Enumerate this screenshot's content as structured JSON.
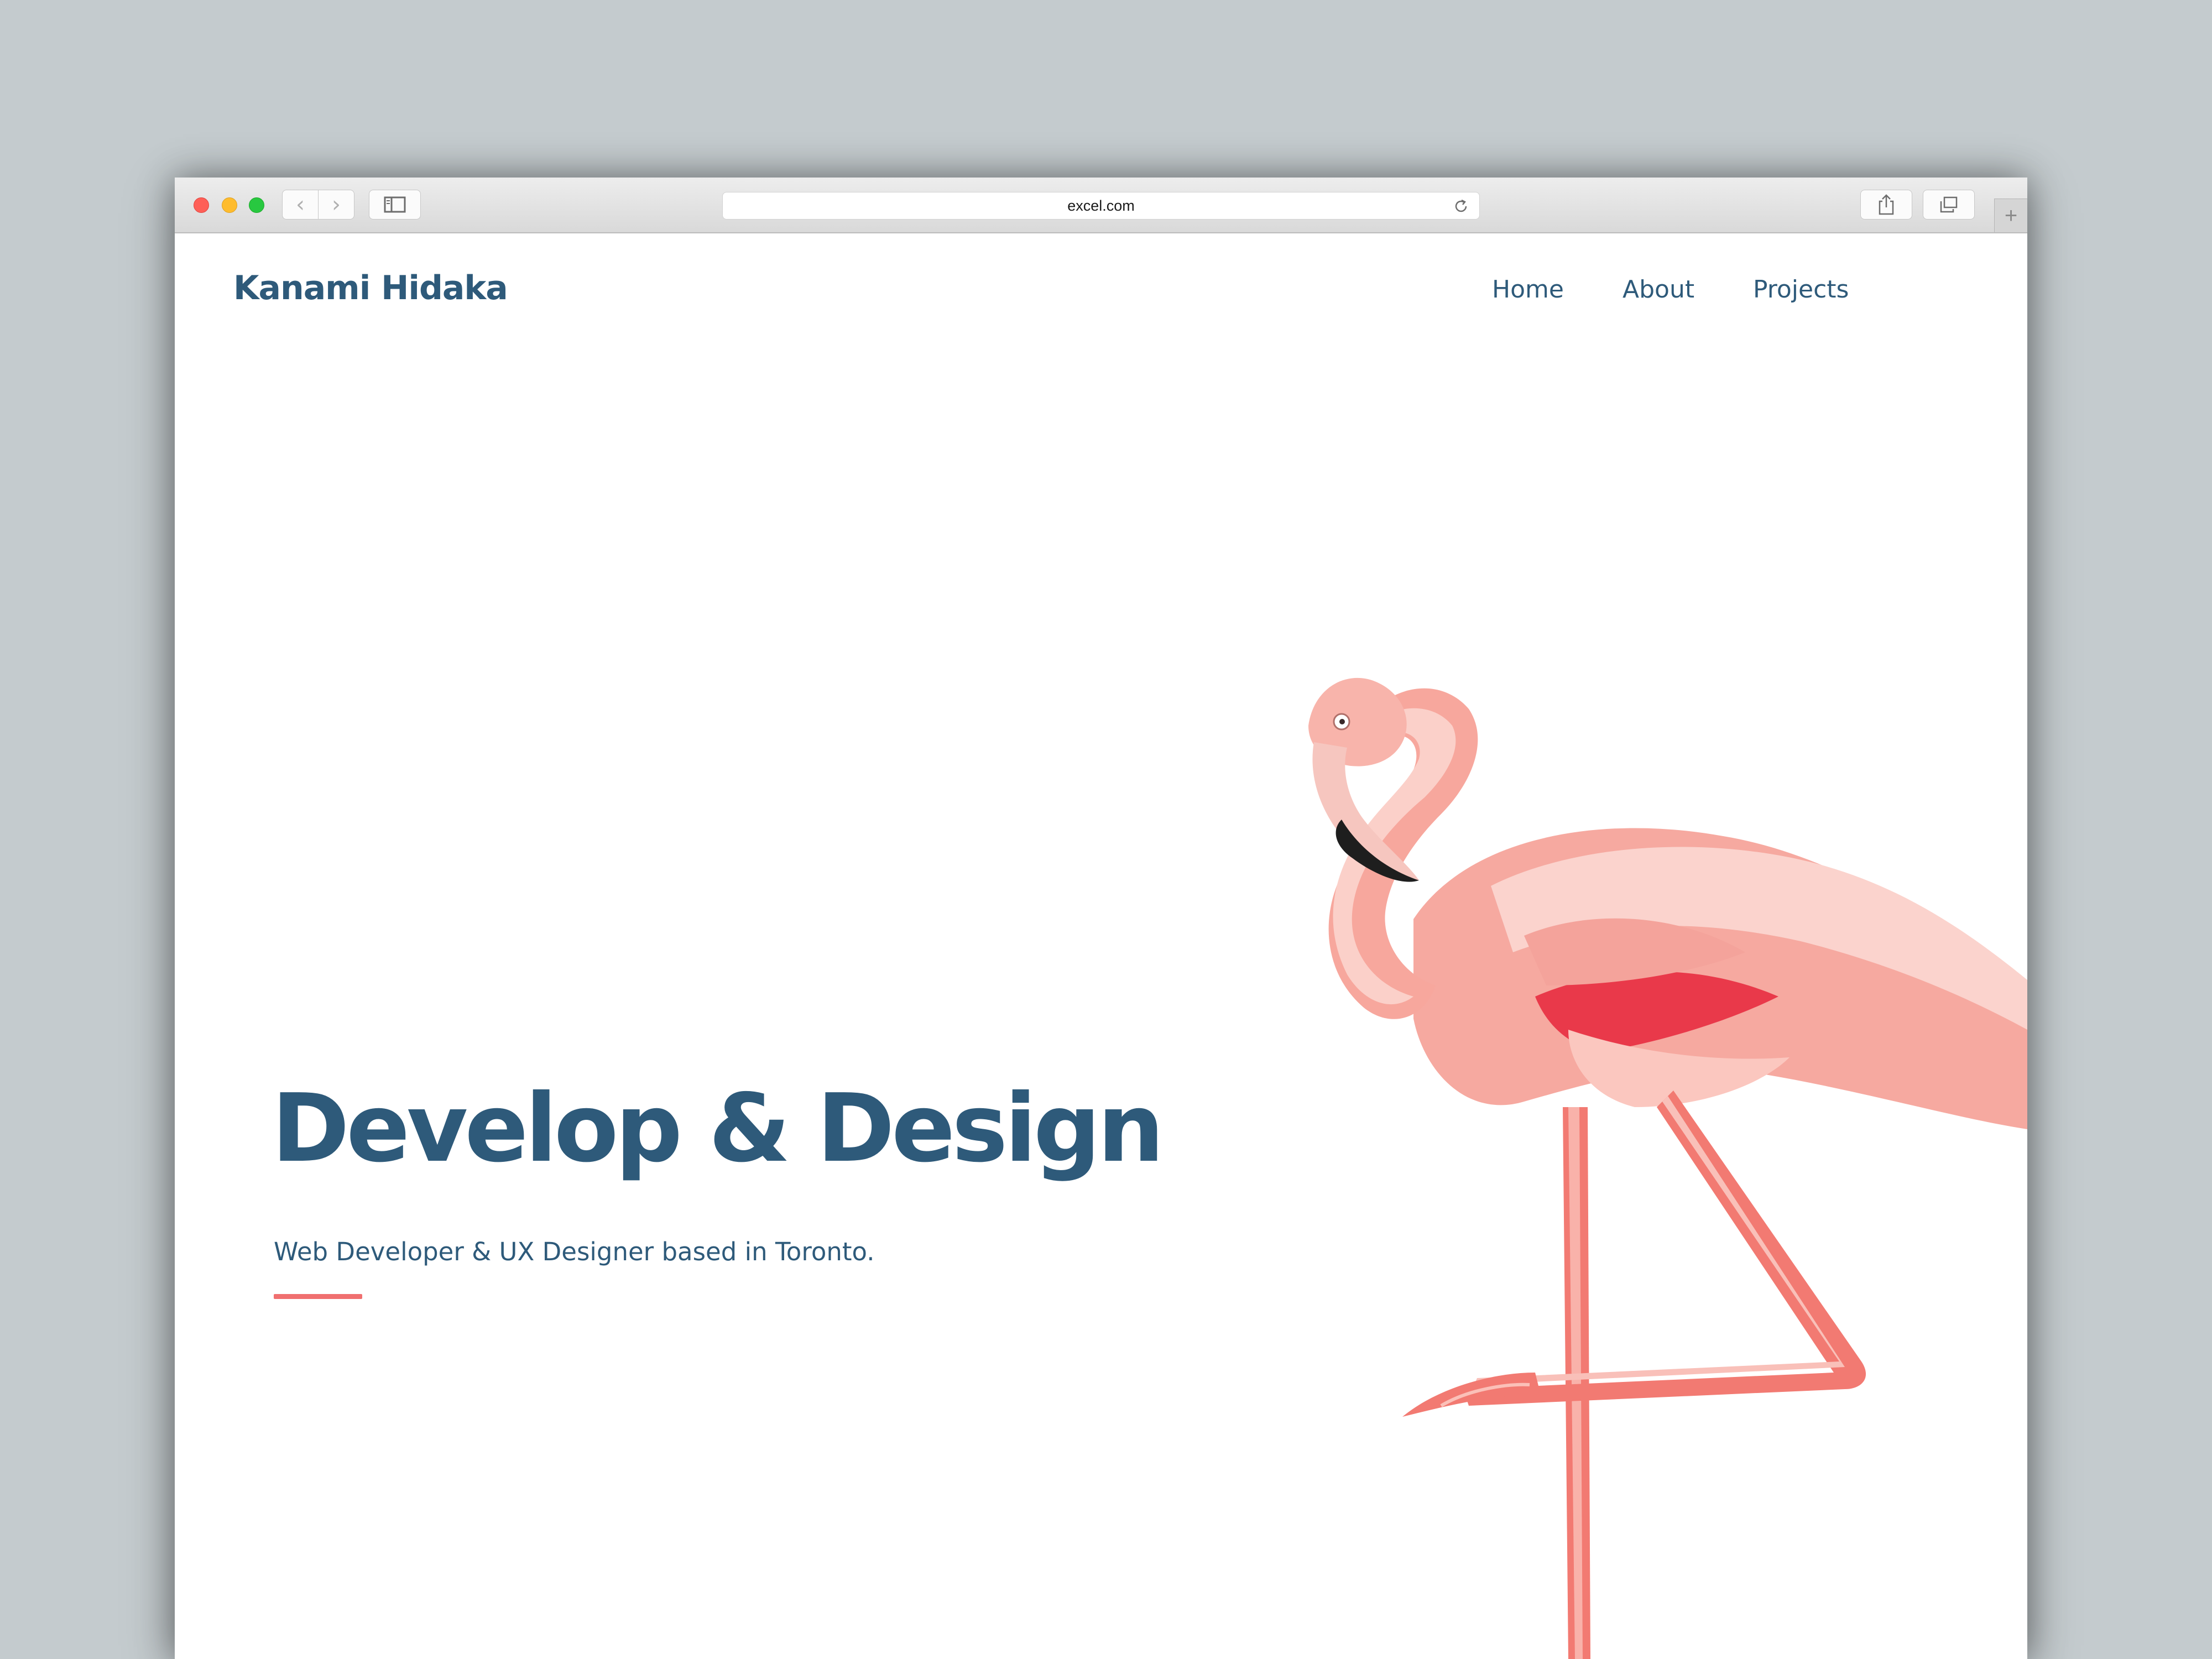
{
  "browser": {
    "url": "excel.com",
    "new_tab_symbol": "+",
    "back_symbol": "‹",
    "forward_symbol": "›"
  },
  "site": {
    "brand": "Kanami Hidaka",
    "nav": [
      "Home",
      "About",
      "Projects"
    ]
  },
  "hero": {
    "title": "Develop & Design",
    "subtitle": "Web Developer & UX Designer based in Toronto."
  },
  "colors": {
    "primary_text": "#2e5a7a",
    "accent": "#f07070",
    "background": "#c4cbce"
  },
  "icons": {
    "reload": "reload-icon",
    "sidebar": "sidebar-icon",
    "share": "share-icon",
    "tabs": "tabs-overview-icon",
    "illustration": "flamingo-illustration"
  }
}
